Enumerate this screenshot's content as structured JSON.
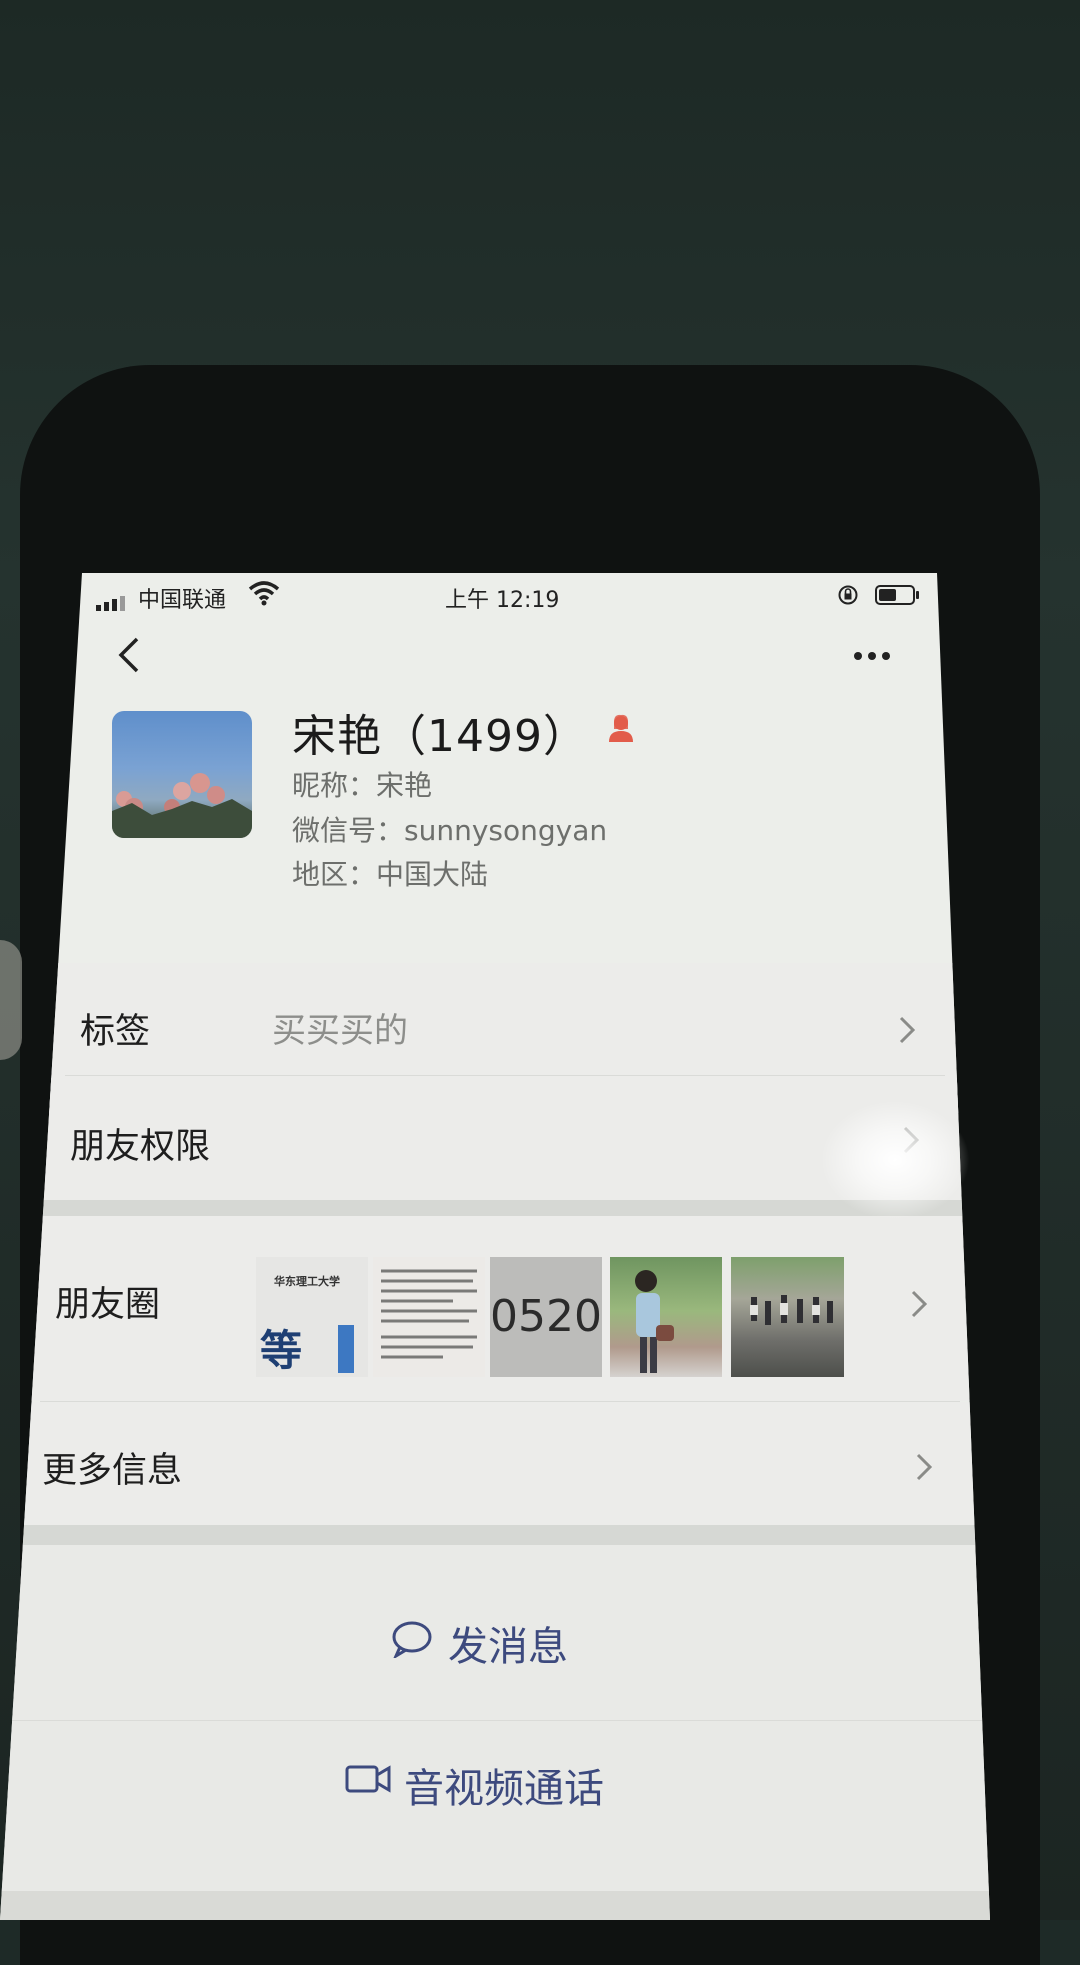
{
  "status_bar": {
    "carrier": "中国联通",
    "time": "上午 12:19"
  },
  "profile": {
    "name": "宋艳（1499）",
    "nickname": "昵称：宋艳",
    "wechat_id": "微信号：sunnysongyan",
    "region": "地区：中国大陆",
    "gender_icon": "female-icon"
  },
  "rows": {
    "tags": {
      "label": "标签",
      "value": "买买买的"
    },
    "permissions": {
      "label": "朋友权限"
    },
    "moments": {
      "label": "朋友圈",
      "thumb_1_title": "华东理工大学",
      "thumb_1_text": "等",
      "thumb_3_text": "0520"
    },
    "more_info": {
      "label": "更多信息"
    }
  },
  "actions": {
    "message": "发消息",
    "call": "音视频通话"
  },
  "colors": {
    "accent": "#3d4a7e",
    "gender": "#e25c4a"
  }
}
